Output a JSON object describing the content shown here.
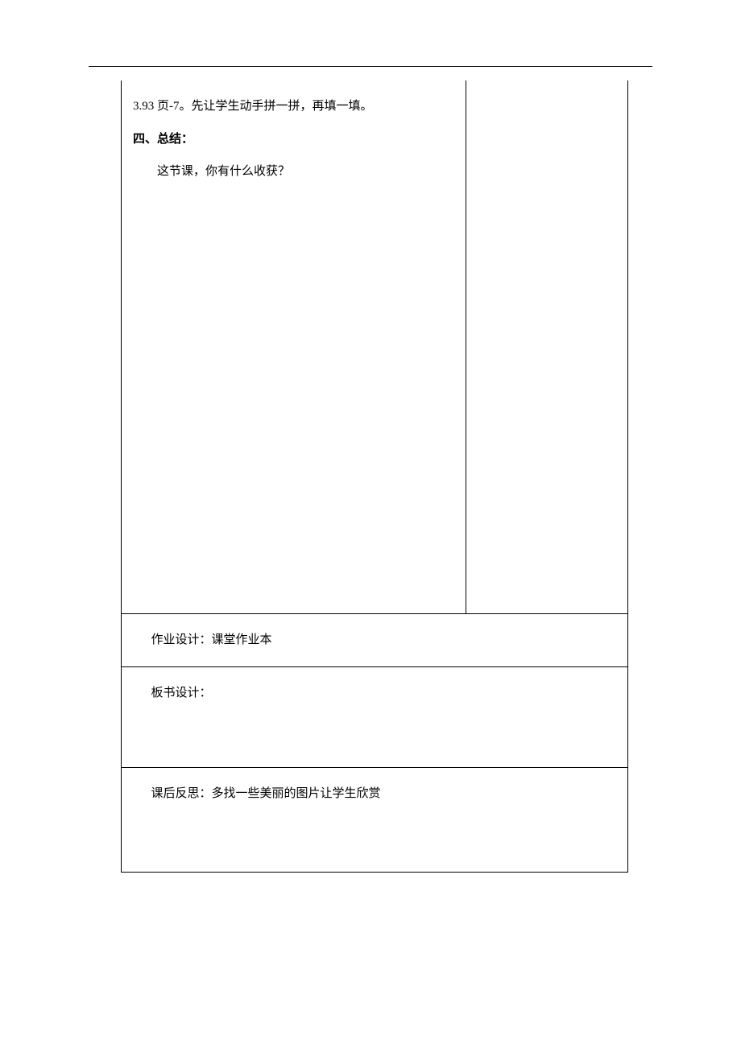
{
  "content": {
    "line1": "3.93 页-7。先让学生动手拼一拼，再填一填。",
    "section4_title": "四、总结：",
    "section4_body": "这节课，你有什么收获？"
  },
  "rows": {
    "homework": "作业设计：课堂作业本",
    "board": "板书设计：",
    "reflect": "课后反思：多找一些美丽的图片让学生欣赏"
  }
}
